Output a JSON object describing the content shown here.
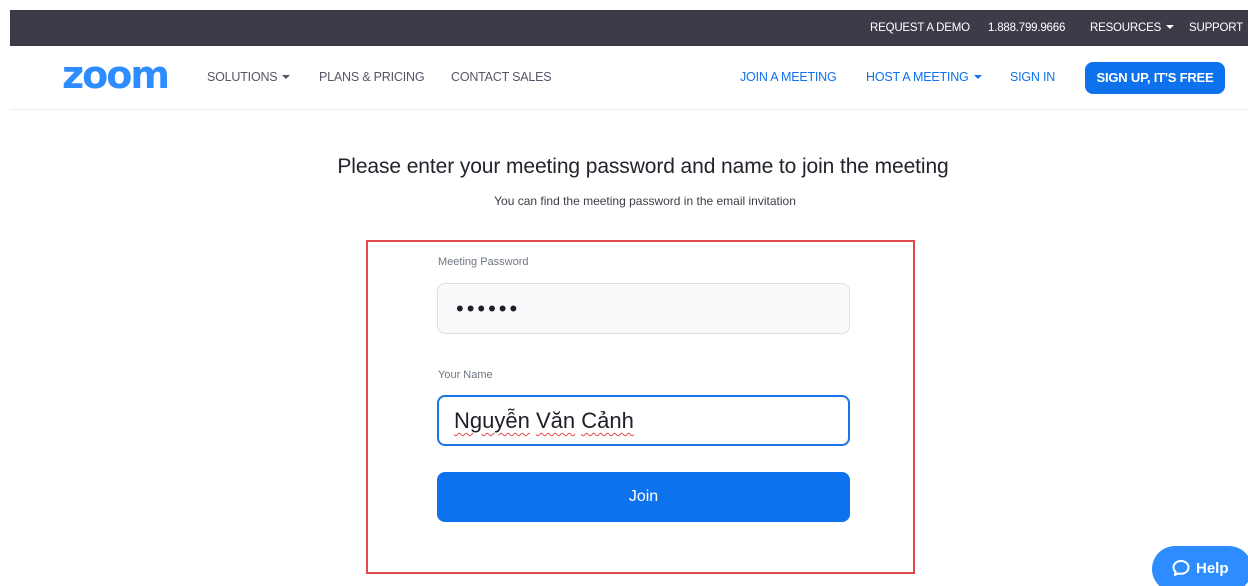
{
  "topbar": {
    "request_demo": "REQUEST A DEMO",
    "phone": "1.888.799.9666",
    "resources": "RESOURCES",
    "support": "SUPPORT"
  },
  "nav": {
    "logo": "zoom",
    "solutions": "SOLUTIONS",
    "plans_pricing": "PLANS & PRICING",
    "contact_sales": "CONTACT SALES",
    "join_meeting": "JOIN A MEETING",
    "host_meeting": "HOST A MEETING",
    "sign_in": "SIGN IN",
    "sign_up": "SIGN UP, IT'S FREE"
  },
  "form": {
    "title": "Please enter your meeting password and name to join the meeting",
    "subtitle": "You can find the meeting password in the email invitation",
    "password_label": "Meeting Password",
    "password_value": "••••••",
    "name_label": "Your Name",
    "name_value_parts": [
      "Nguyễn",
      "Văn",
      "Cảnh"
    ],
    "join_label": "Join"
  },
  "help": {
    "label": "Help",
    "icon": "chat-bubble-icon"
  },
  "colors": {
    "topbar_bg": "#3c3c48",
    "brand_blue": "#0e72ed",
    "logo_blue": "#2d8cff",
    "highlight_red": "#e0484a"
  }
}
